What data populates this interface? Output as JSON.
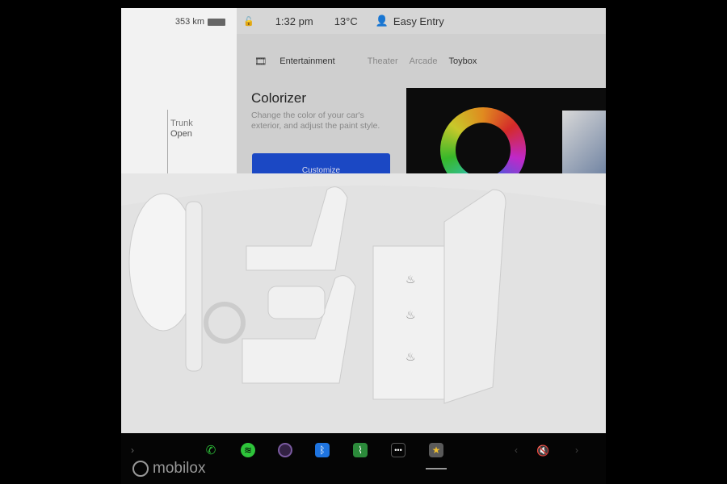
{
  "status": {
    "range": "353 km",
    "time": "1:32 pm",
    "temperature": "13°C",
    "profile": "Easy Entry"
  },
  "trunk": {
    "label": "Trunk",
    "state": "Open"
  },
  "entertainment": {
    "section": "Entertainment",
    "tabs": [
      "Theater",
      "Arcade",
      "Toybox"
    ],
    "active_tab": "Toybox",
    "card": {
      "title": "Colorizer",
      "description": "Change the color of your car's exterior, and adjust the paint style.",
      "button": "Customize"
    }
  },
  "dock": {
    "apps": [
      "phone-icon",
      "spotify-icon",
      "camera-icon",
      "bluetooth-icon",
      "stocks-icon",
      "more-icon",
      "toybox-icon"
    ],
    "volume": "muted"
  },
  "watermark": "mobilox",
  "colors": {
    "accent": "#1b48c4",
    "background": "#e8e8e8"
  }
}
